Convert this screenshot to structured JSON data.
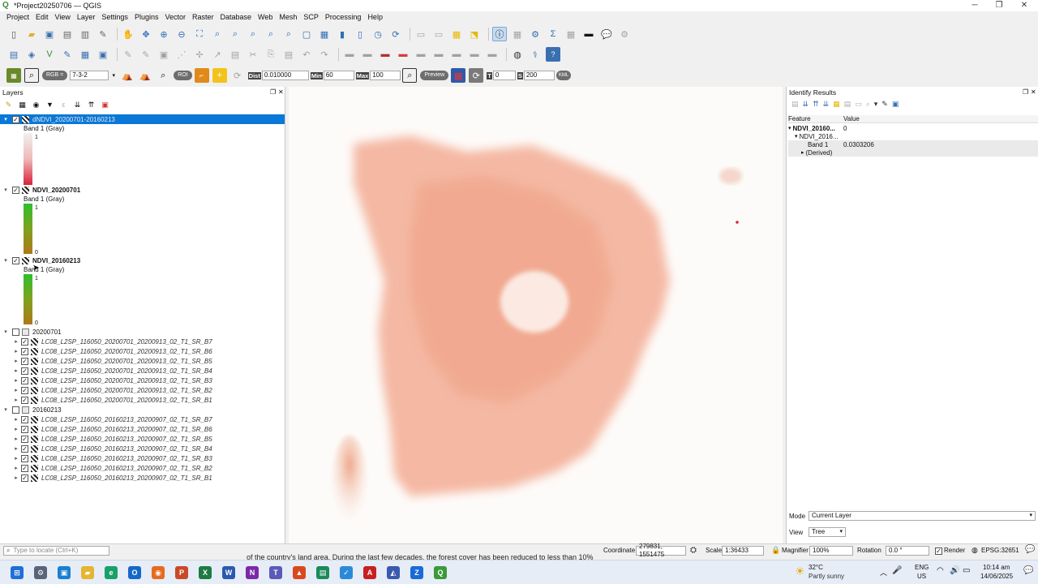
{
  "window": {
    "title": "*Project20250706 — QGIS"
  },
  "menu": [
    "Project",
    "Edit",
    "View",
    "Layer",
    "Settings",
    "Plugins",
    "Vector",
    "Raster",
    "Database",
    "Web",
    "Mesh",
    "SCP",
    "Processing",
    "Help"
  ],
  "scp_toolbar": {
    "rgb_label": "RGB =",
    "rgb_value": "7-3-2",
    "roi_label": "ROI",
    "dist_label": "Dist",
    "dist_value": "0.010000",
    "min_label": "Min",
    "min_value": "60",
    "max_label": "Max",
    "max_value": "100",
    "preview_label": "Preview",
    "t_label": "T",
    "t_value": "0",
    "s_label": "S",
    "s_value": "200",
    "kml_label": "KML"
  },
  "layers_panel": {
    "title": "Layers",
    "items": [
      {
        "name": "dNDVI_20200701-20160213",
        "band": "Band 1 (Gray)",
        "max": "1",
        "min": ""
      },
      {
        "name": "NDVI_20200701",
        "band": "Band 1 (Gray)",
        "max": "1",
        "min": "0"
      },
      {
        "name": "NDVI_20160213",
        "band": "Band 1 (Gray)",
        "max": "1",
        "min": "0"
      }
    ],
    "groups": [
      {
        "name": "20200701",
        "layers": [
          "LC08_L2SP_116050_20200701_20200913_02_T1_SR_B7",
          "LC08_L2SP_116050_20200701_20200913_02_T1_SR_B6",
          "LC08_L2SP_116050_20200701_20200913_02_T1_SR_B5",
          "LC08_L2SP_116050_20200701_20200913_02_T1_SR_B4",
          "LC08_L2SP_116050_20200701_20200913_02_T1_SR_B3",
          "LC08_L2SP_116050_20200701_20200913_02_T1_SR_B2",
          "LC08_L2SP_116050_20200701_20200913_02_T1_SR_B1"
        ]
      },
      {
        "name": "20160213",
        "layers": [
          "LC08_L2SP_116050_20160213_20200907_02_T1_SR_B7",
          "LC08_L2SP_116050_20160213_20200907_02_T1_SR_B6",
          "LC08_L2SP_116050_20160213_20200907_02_T1_SR_B5",
          "LC08_L2SP_116050_20160213_20200907_02_T1_SR_B4",
          "LC08_L2SP_116050_20160213_20200907_02_T1_SR_B3",
          "LC08_L2SP_116050_20160213_20200907_02_T1_SR_B2",
          "LC08_L2SP_116050_20160213_20200907_02_T1_SR_B1"
        ]
      }
    ]
  },
  "identify_panel": {
    "title": "Identify Results",
    "col_feature": "Feature",
    "col_value": "Value",
    "rows": [
      {
        "feature": "NDVI_20160...",
        "value": "0"
      },
      {
        "feature": "NDVI_2016...",
        "value": ""
      },
      {
        "feature": "Band 1",
        "value": "0.0303206"
      },
      {
        "feature": "(Derived)",
        "value": ""
      }
    ],
    "mode_label": "Mode",
    "mode_value": "Current Layer",
    "view_label": "View",
    "view_value": "Tree"
  },
  "statusbar": {
    "locate_placeholder": "Type to locate (Ctrl+K)",
    "subtitle": "of the country's land area. During the last few decades, the forest cover has been reduced to less than 10%",
    "coordinate_label": "Coordinate",
    "coordinate_value": "279831, 1551475",
    "scale_label": "Scale",
    "scale_value": "1:36433",
    "magnifier_label": "Magnifier",
    "magnifier_value": "100%",
    "rotation_label": "Rotation",
    "rotation_value": "0.0 °",
    "render_label": "Render",
    "crs_label": "EPSG:32651"
  },
  "taskbar": {
    "weather_temp": "32°C",
    "weather_desc": "Partly sunny",
    "lang_top": "ENG",
    "lang_bottom": "US",
    "time": "10:14 am",
    "date": "14/06/2025"
  },
  "colors": {
    "selection": "#0a78d7",
    "map_fill": "#f2a58a",
    "ndvi_green": "#2fbf2f",
    "dndvi_red": "#d8223a"
  }
}
